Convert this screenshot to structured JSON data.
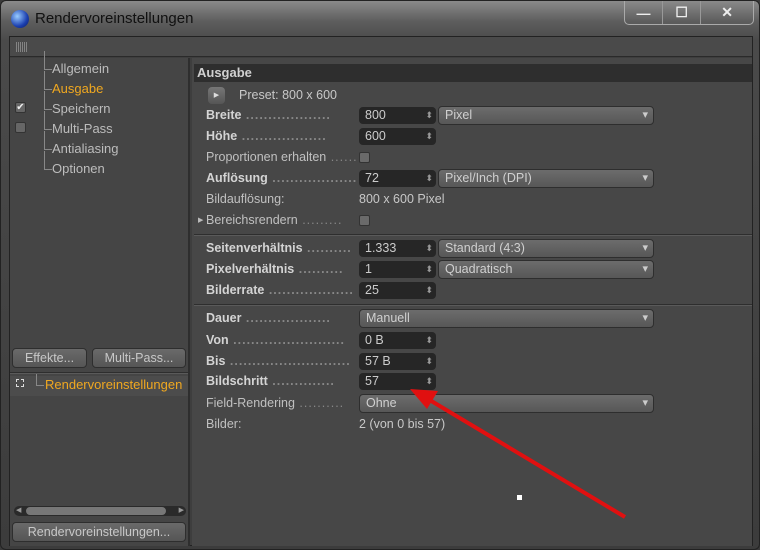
{
  "window": {
    "title": "Rendervoreinstellungen",
    "minimize": "—",
    "maximize": "☐",
    "close": "✕"
  },
  "sidebar": {
    "items": [
      {
        "label": "Allgemein"
      },
      {
        "label": "Ausgabe",
        "selected": true
      },
      {
        "label": "Speichern",
        "checked": true,
        "check": "✔"
      },
      {
        "label": "Multi-Pass",
        "checked": false
      },
      {
        "label": "Antialiasing"
      },
      {
        "label": "Optionen"
      }
    ],
    "effects_button": "Effekte...",
    "multipass_button": "Multi-Pass...",
    "tree_item": "Rendervoreinstellungen",
    "bottom_button": "Rendervoreinstellungen..."
  },
  "panel": {
    "header": "Ausgabe",
    "preset": "Preset: 800 x 600",
    "breite": {
      "label": "Breite",
      "value": "800",
      "unit": "Pixel"
    },
    "hoehe": {
      "label": "Höhe",
      "value": "600"
    },
    "proportionen": {
      "label": "Proportionen erhalten",
      "checked": false
    },
    "aufloesung": {
      "label": "Auflösung",
      "value": "72",
      "unit": "Pixel/Inch (DPI)"
    },
    "bildaufloesung": {
      "label": "Bildauflösung:",
      "value": "800 x 600 Pixel"
    },
    "bereichsrendern": {
      "label": "Bereichsrendern",
      "checked": false
    },
    "seitenverhaeltnis": {
      "label": "Seitenverhältnis",
      "value": "1.333",
      "option": "Standard (4:3)"
    },
    "pixelverhaeltnis": {
      "label": "Pixelverhältnis",
      "value": "1",
      "option": "Quadratisch"
    },
    "bilderrate": {
      "label": "Bilderrate",
      "value": "25"
    },
    "dauer": {
      "label": "Dauer",
      "option": "Manuell"
    },
    "von": {
      "label": "Von",
      "value": "0 B"
    },
    "bis": {
      "label": "Bis",
      "value": "57 B"
    },
    "bildschritt": {
      "label": "Bildschritt",
      "value": "57"
    },
    "field_rendering": {
      "label": "Field-Rendering",
      "option": "Ohne"
    },
    "bilder": {
      "label": "Bilder:",
      "value": "2 (von 0 bis 57)"
    }
  },
  "colors": {
    "accent": "#f0a820",
    "annotation_arrow": "#e01010"
  }
}
